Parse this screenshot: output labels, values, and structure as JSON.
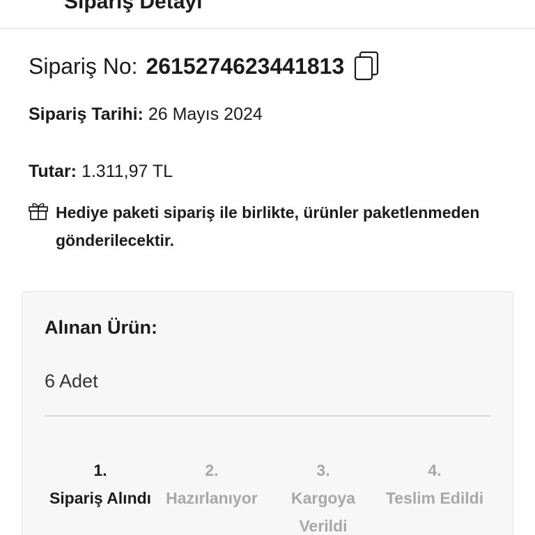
{
  "header": {
    "title": "Sipariş Detayı"
  },
  "order": {
    "number_label": "Sipariş No:",
    "number_value": "2615274623441813",
    "date_label": "Sipariş Tarihi:",
    "date_value": "26 Mayıs 2024",
    "amount_label": "Tutar:",
    "amount_value": "1.311,97 TL",
    "gift_note": "Hediye paketi sipariş ile birlikte, ürünler paketlenmeden gönderilecektir."
  },
  "product_card": {
    "title": "Alınan Ürün:",
    "quantity": "6 Adet",
    "steps": [
      {
        "number": "1.",
        "label": "Sipariş Alındı",
        "state": "active"
      },
      {
        "number": "2.",
        "label": "Hazırlanıyor",
        "state": "inactive"
      },
      {
        "number": "3.",
        "label": "Kargoya Verildi",
        "state": "inactive"
      },
      {
        "number": "4.",
        "label": "Teslim Edildi",
        "state": "inactive"
      }
    ]
  },
  "colors": {
    "text": "#1b1b1b",
    "inactive_step": "#a8a8a8",
    "card_bg": "#f7f7f7",
    "divider": "#d8d8d8"
  },
  "icons": [
    "back-arrow-icon",
    "copy-icon",
    "gift-icon"
  ]
}
